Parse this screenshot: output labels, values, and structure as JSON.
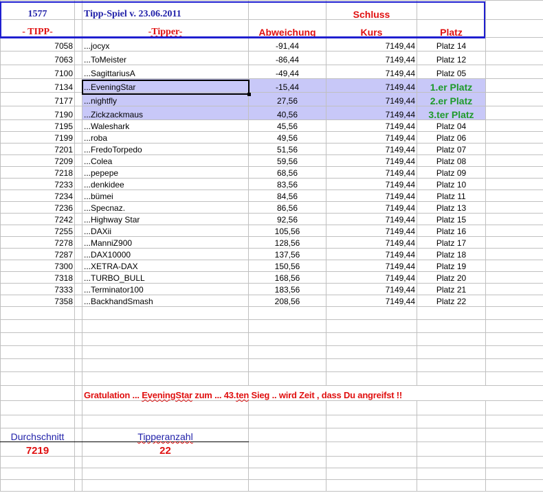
{
  "header": {
    "count": "1577",
    "title": "Tipp-Spiel v. 23.06.2011",
    "schluss": "Schluss",
    "col_tipp": "- TIPP-",
    "col_tipper": "-Tipper-",
    "col_abweichung": "Abweichung",
    "col_kurs": "Kurs",
    "col_platz": "Platz"
  },
  "rows": [
    {
      "tipp": "7058",
      "name": "...jocyx",
      "abw": "-91,44",
      "kurs": "7149,44",
      "platz": "Platz 14"
    },
    {
      "tipp": "7063",
      "name": "...ToMeister",
      "abw": "-86,44",
      "kurs": "7149,44",
      "platz": "Platz 12"
    },
    {
      "tipp": "7100",
      "name": "...SagittariusA",
      "abw": "-49,44",
      "kurs": "7149,44",
      "platz": "Platz 05"
    },
    {
      "tipp": "7134",
      "name": "...EveningStar",
      "abw": "-15,44",
      "kurs": "7149,44",
      "platz": "1.er Platz",
      "highlight": true
    },
    {
      "tipp": "7177",
      "name": "...nightfly",
      "abw": "27,56",
      "kurs": "7149,44",
      "platz": "2.er Platz",
      "highlight": true
    },
    {
      "tipp": "7190",
      "name": "...Zickzackmaus",
      "abw": "40,56",
      "kurs": "7149,44",
      "platz": "3.ter Platz",
      "highlight": true
    },
    {
      "tipp": "7195",
      "name": "...Waleshark",
      "abw": "45,56",
      "kurs": "7149,44",
      "platz": "Platz 04"
    },
    {
      "tipp": "7199",
      "name": "...roba",
      "abw": "49,56",
      "kurs": "7149,44",
      "platz": "Platz 06"
    },
    {
      "tipp": "7201",
      "name": "...FredoTorpedo",
      "abw": "51,56",
      "kurs": "7149,44",
      "platz": "Platz 07"
    },
    {
      "tipp": "7209",
      "name": "...Colea",
      "abw": "59,56",
      "kurs": "7149,44",
      "platz": "Platz 08"
    },
    {
      "tipp": "7218",
      "name": "...pepepe",
      "abw": "68,56",
      "kurs": "7149,44",
      "platz": "Platz 09"
    },
    {
      "tipp": "7233",
      "name": "...denkidee",
      "abw": "83,56",
      "kurs": "7149,44",
      "platz": "Platz 10"
    },
    {
      "tipp": "7234",
      "name": "...bümei",
      "abw": "84,56",
      "kurs": "7149,44",
      "platz": "Platz 11"
    },
    {
      "tipp": "7236",
      "name": "...Specnaz.",
      "abw": "86,56",
      "kurs": "7149,44",
      "platz": "Platz 13"
    },
    {
      "tipp": "7242",
      "name": "...Highway Star",
      "abw": "92,56",
      "kurs": "7149,44",
      "platz": "Platz 15"
    },
    {
      "tipp": "7255",
      "name": "...DAXii",
      "abw": "105,56",
      "kurs": "7149,44",
      "platz": "Platz 16"
    },
    {
      "tipp": "7278",
      "name": "...ManniZ900",
      "abw": "128,56",
      "kurs": "7149,44",
      "platz": "Platz 17"
    },
    {
      "tipp": "7287",
      "name": "...DAX10000",
      "abw": "137,56",
      "kurs": "7149,44",
      "platz": "Platz 18"
    },
    {
      "tipp": "7300",
      "name": "...XETRA-DAX",
      "abw": "150,56",
      "kurs": "7149,44",
      "platz": "Platz 19"
    },
    {
      "tipp": "7318",
      "name": "...TURBO_BULL",
      "abw": "168,56",
      "kurs": "7149,44",
      "platz": "Platz 20"
    },
    {
      "tipp": "7333",
      "name": "...Terminator100",
      "abw": "183,56",
      "kurs": "7149,44",
      "platz": "Platz 21"
    },
    {
      "tipp": "7358",
      "name": "...BackhandSmash",
      "abw": "208,56",
      "kurs": "7149,44",
      "platz": "Platz 22"
    }
  ],
  "message": {
    "part1": "Gratulation ... ",
    "winner": "EveningStar",
    "part2": " zum   ... 43.",
    "ten": "ten",
    "part3": " Sieg .. wird Zeit , dass Du angreifst !!"
  },
  "summary": {
    "avg_label": "Durchschnitt",
    "avg_value": "7219",
    "count_label": "Tipperanzahl",
    "count_value": "22"
  }
}
